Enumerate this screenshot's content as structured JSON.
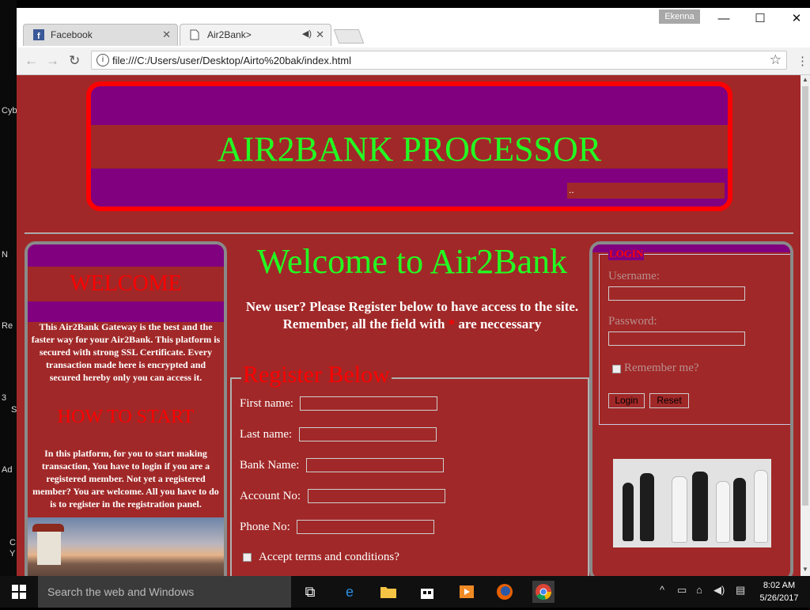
{
  "desktop": {
    "labels": [
      "Cyb",
      "N",
      "Re",
      "3",
      "S",
      "Ad",
      "C",
      "Y"
    ]
  },
  "browser": {
    "user_badge": "Ekenna",
    "tabs": [
      {
        "label": "Facebook",
        "icon": "facebook-icon"
      },
      {
        "label": "Air2Bank>",
        "icon": "document-icon"
      }
    ],
    "url": "file:///C:/Users/user/Desktop/Airto%20bak/index.html",
    "window_controls": {
      "minimize": "—",
      "maximize": "☐",
      "close": "✕"
    }
  },
  "header": {
    "title": "AIR2BANK PROCESSOR",
    "strip_text": ".."
  },
  "left_panel": {
    "welcome_title": "WELCOME",
    "welcome_text": "This Air2Bank Gateway is the best and the faster way for your Air2Bank. This platform is secured with strong SSL Certificate. Every transaction made here is encrypted and secured hereby only you can access it.",
    "how_title": "HOW TO START",
    "how_text": "In this platform, for you to start making transaction, You have to login if you are a registered member. Not yet a registered member? You are welcome. All you have to do is to register in the registration panel."
  },
  "main": {
    "welcome_title": "Welcome to Air2Bank",
    "intro_before": "New user? Please Register below to have access to the site. Remember, all the field with",
    "intro_mark": "*",
    "intro_after": "are neccessary"
  },
  "register": {
    "legend": "Register Below",
    "fields": [
      {
        "label": "First name:",
        "value": ""
      },
      {
        "label": "Last name:",
        "value": ""
      },
      {
        "label": "Bank Name:",
        "value": ""
      },
      {
        "label": "Account No:",
        "value": ""
      },
      {
        "label": "Phone No:",
        "value": ""
      }
    ],
    "terms_label": "Accept terms and conditions?",
    "terms_checked": false
  },
  "login": {
    "legend": "LOGIN",
    "username_label": "Username:",
    "username_value": "",
    "password_label": "Password:",
    "password_value": "",
    "remember_label": "Remember me?",
    "remember_checked": false,
    "login_button": "Login",
    "reset_button": "Reset"
  },
  "taskbar": {
    "search_placeholder": "Search the web and Windows",
    "time": "8:02 AM",
    "date": "5/26/2017"
  },
  "colors": {
    "page_bg": "#a12828",
    "header_purple": "#800080",
    "header_border": "#ff0000",
    "title_green": "#22ff22",
    "section_red": "#ff0000"
  }
}
